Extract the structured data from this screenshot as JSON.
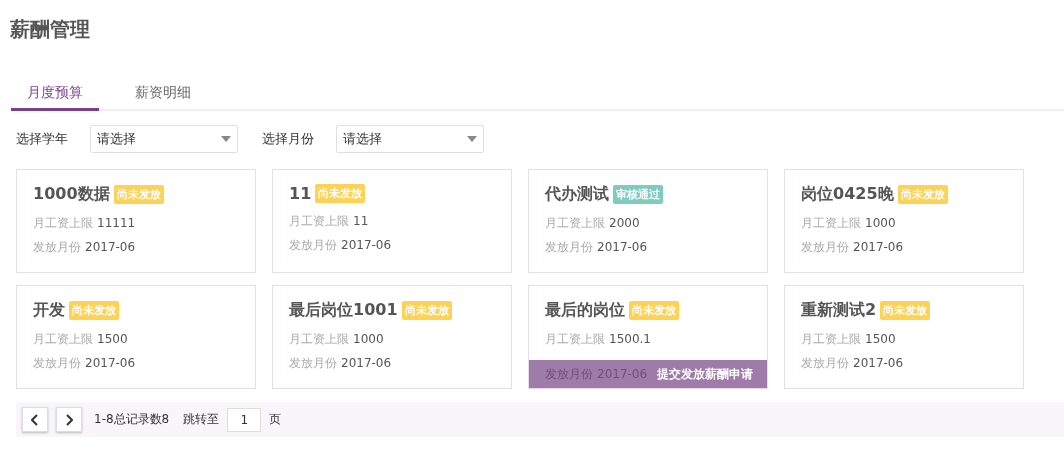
{
  "page_title": "薪酬管理",
  "tabs": [
    {
      "label": "月度预算",
      "selected": true
    },
    {
      "label": "薪资明细",
      "selected": false
    }
  ],
  "filters": [
    {
      "label": "选择学年",
      "placeholder": "请选择"
    },
    {
      "label": "选择月份",
      "placeholder": "请选择"
    }
  ],
  "cards": [
    {
      "name": "1000数据",
      "status": "尚未发放",
      "color": "#fdd256",
      "limit_label": "月工资上限",
      "limit": "11111",
      "month_label": "发放月份",
      "month": "2017-06",
      "hovered": false
    },
    {
      "name": "11",
      "status": "尚未发放",
      "color": "#fdd256",
      "limit_label": "月工资上限",
      "limit": "11",
      "month_label": "发放月份",
      "month": "2017-06",
      "hovered": false
    },
    {
      "name": "代办测试",
      "status": "审核通过",
      "color": "#7fcbc0",
      "limit_label": "月工资上限",
      "limit": "2000",
      "month_label": "发放月份",
      "month": "2017-06",
      "hovered": false
    },
    {
      "name": "岗位0425晚",
      "status": "尚未发放",
      "color": "#fdd256",
      "limit_label": "月工资上限",
      "limit": "1000",
      "month_label": "发放月份",
      "month": "2017-06",
      "hovered": false
    },
    {
      "name": "开发",
      "status": "尚未发放",
      "color": "#fdd256",
      "limit_label": "月工资上限",
      "limit": "1500",
      "month_label": "发放月份",
      "month": "2017-06",
      "hovered": false
    },
    {
      "name": "最后岗位1001",
      "status": "尚未发放",
      "color": "#fdd256",
      "limit_label": "月工资上限",
      "limit": "1000",
      "month_label": "发放月份",
      "month": "2017-06",
      "hovered": false
    },
    {
      "name": "最后的岗位",
      "status": "尚未发放",
      "color": "#fdd256",
      "limit_label": "月工资上限",
      "limit": "1500.1",
      "month_label": "发放月份",
      "month": "2017-06",
      "hovered": true,
      "action": "提交发放薪酬申请"
    },
    {
      "name": "重新测试2",
      "status": "尚未发放",
      "color": "#fdd256",
      "limit_label": "月工资上限",
      "limit": "1500",
      "month_label": "发放月份",
      "month": "2017-06",
      "hovered": false
    }
  ],
  "pagination": {
    "summary": "1-8总记录数8",
    "jump_label": "跳转至",
    "page": "1",
    "page_unit": "页"
  }
}
